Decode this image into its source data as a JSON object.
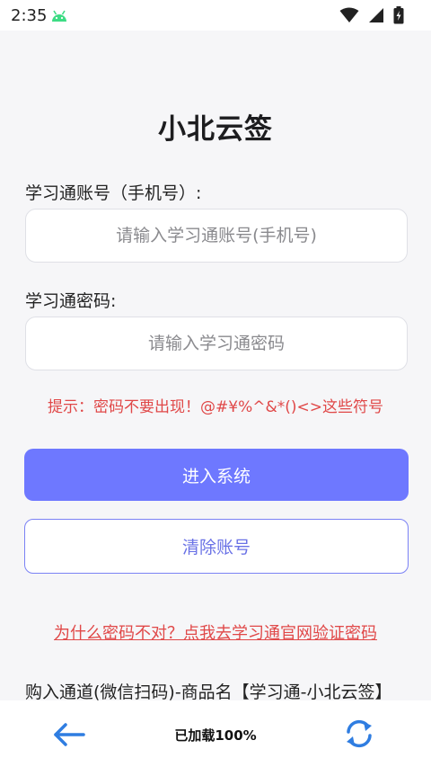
{
  "status_bar": {
    "time": "2:35",
    "icons": [
      "android-debug-icon",
      "wifi-icon",
      "signal-icon",
      "battery-charging-icon"
    ]
  },
  "app": {
    "title": "小北云签"
  },
  "form": {
    "account_label": "学习通账号（手机号）:",
    "account_placeholder": "请输入学习通账号(手机号)",
    "password_label": "学习通密码:",
    "password_placeholder": "请输入学习通密码",
    "hint": "提示：密码不要出现！@#¥%^&*()<>这些符号"
  },
  "buttons": {
    "login": "进入系统",
    "clear": "清除账号"
  },
  "links": {
    "verify": "为什么密码不对？点我去学习通官网验证密码"
  },
  "purchase": {
    "text": "购入通道(微信扫码)-商品名【学习通-小北云签】"
  },
  "bottom_bar": {
    "load_status": "已加载100%"
  },
  "colors": {
    "accent": "#6e78ff",
    "warning": "#e04848",
    "nav_icon": "#2f7de1",
    "android_green": "#3ddc84"
  }
}
